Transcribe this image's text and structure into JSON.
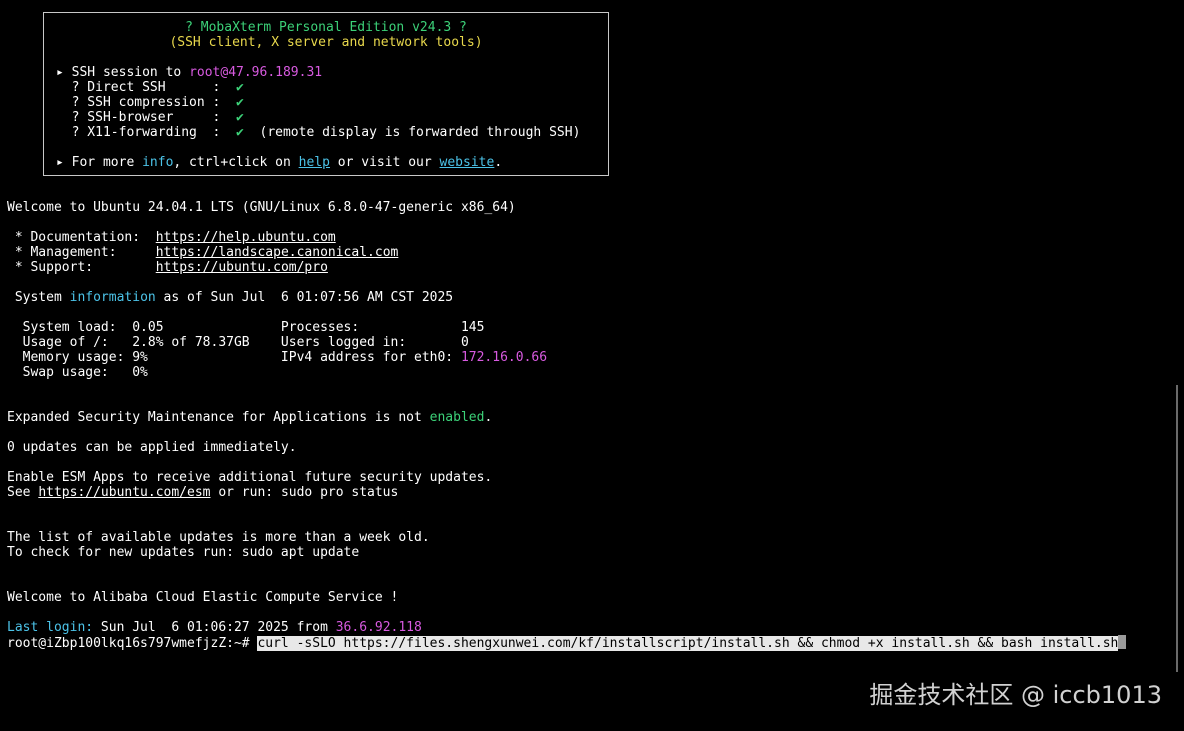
{
  "banner": {
    "title": "? MobaXterm Personal Edition v24.3 ?",
    "subtitle": "(SSH client, X server and network tools)",
    "session_prefix": "▸ SSH session to ",
    "session_host": "root@47.96.189.31",
    "features": [
      {
        "label": "  ? Direct SSH      :  ",
        "value": "✔",
        "note": ""
      },
      {
        "label": "  ? SSH compression :  ",
        "value": "✔",
        "note": ""
      },
      {
        "label": "  ? SSH-browser     :  ",
        "value": "✔",
        "note": ""
      },
      {
        "label": "  ? X11-forwarding  :  ",
        "value": "✔",
        "note": "  (remote display is forwarded through SSH)"
      }
    ],
    "more_prefix": "▸ For more ",
    "more_info": "info",
    "more_mid": ", ctrl+click on ",
    "more_help": "help",
    "more_mid2": " or visit our ",
    "more_website": "website",
    "more_end": "."
  },
  "welcome": "Welcome to Ubuntu 24.04.1 LTS (GNU/Linux 6.8.0-47-generic x86_64)",
  "links": [
    {
      "label": " * Documentation:  ",
      "url": "https://help.ubuntu.com"
    },
    {
      "label": " * Management:     ",
      "url": "https://landscape.canonical.com"
    },
    {
      "label": " * Support:        ",
      "url": "https://ubuntu.com/pro"
    }
  ],
  "sysinfo": {
    "prefix": " System ",
    "word": "information",
    "suffix": " as of Sun Jul  6 01:07:56 AM CST 2025"
  },
  "stats": [
    {
      "left": "  System load:  0.05               Processes:             145",
      "highlight": ""
    },
    {
      "left": "  Usage of /:   2.8% of 78.37GB    Users logged in:       0",
      "highlight": ""
    },
    {
      "left": "  Memory usage: 9%                 IPv4 address for eth0: ",
      "highlight": "172.16.0.66"
    },
    {
      "left": "  Swap usage:   0%",
      "highlight": ""
    }
  ],
  "esm": {
    "prefix": "Expanded Security Maintenance for Applications is not ",
    "word": "enabled",
    "suffix": "."
  },
  "updates": "0 updates can be applied immediately.",
  "esm_apps": "Enable ESM Apps to receive additional future security updates.",
  "see_prefix": "See ",
  "see_url": "https://ubuntu.com/esm",
  "see_suffix": " or run: sudo pro status",
  "list_old": "The list of available updates is more than a week old.",
  "check_updates": "To check for new updates run: sudo apt update",
  "alibaba": "Welcome to Alibaba Cloud Elastic Compute Service !",
  "last_login": {
    "label": "Last login:",
    "time": " Sun Jul  6 01:06:27 2025 from ",
    "ip": "36.6.92.118"
  },
  "prompt": "root@iZbp100lkq16s797wmefjzZ:~# ",
  "command": "curl -sSLO https://files.shengxunwei.com/kf/installscript/install.sh && chmod +x install.sh && bash install.sh",
  "watermark": "掘金技术社区 @ iccb1013"
}
